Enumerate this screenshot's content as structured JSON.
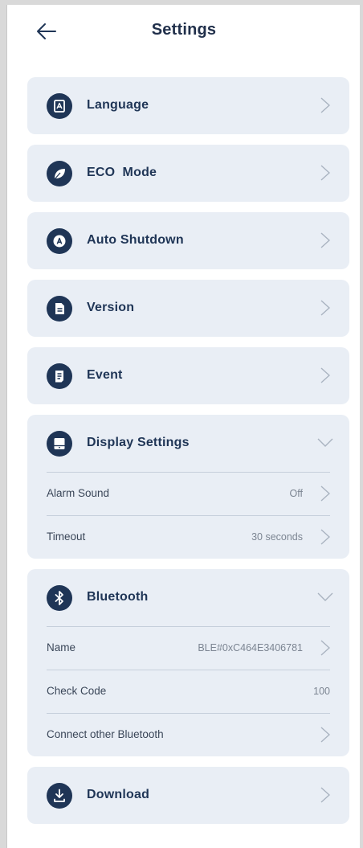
{
  "header": {
    "title": "Settings"
  },
  "menu": {
    "language": "Language",
    "eco_mode": "ECO  Mode",
    "auto_shutdown": "Auto Shutdown",
    "version": "Version",
    "event": "Event",
    "display_settings": "Display Settings",
    "bluetooth": "Bluetooth",
    "download": "Download"
  },
  "display": {
    "alarm_sound": {
      "label": "Alarm Sound",
      "value": "Off"
    },
    "timeout": {
      "label": "Timeout",
      "value": "30 seconds"
    }
  },
  "bluetooth": {
    "name": {
      "label": "Name",
      "value": "BLE#0xC464E3406781"
    },
    "check_code": {
      "label": "Check Code",
      "value": "100"
    },
    "connect_other": {
      "label": "Connect other Bluetooth"
    }
  },
  "colors": {
    "primary": "#1f3556",
    "card_bg": "#e9eef5",
    "divider": "#c6cfdb",
    "chevron": "#a9b3c0"
  },
  "icons": {
    "back": "arrow-left-icon",
    "language": "language-icon",
    "eco": "leaf-icon",
    "auto_shutdown": "auto-icon",
    "version": "document-icon",
    "event": "event-icon",
    "display": "display-icon",
    "bluetooth": "bluetooth-icon",
    "download": "download-icon"
  }
}
